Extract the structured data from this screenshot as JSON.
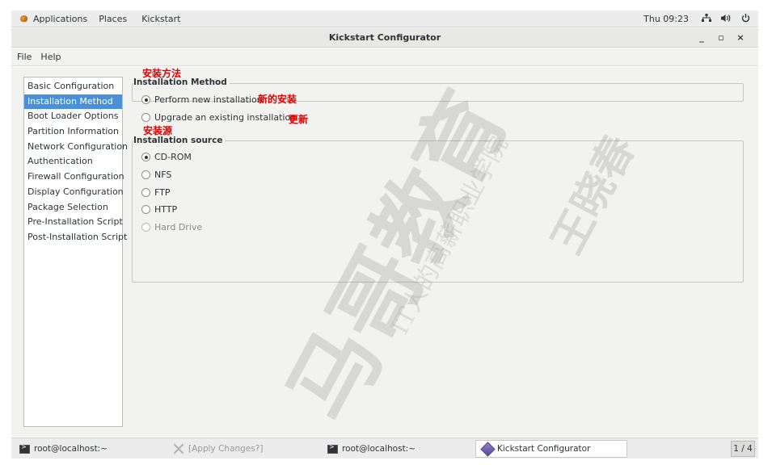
{
  "top_panel": {
    "applications": "Applications",
    "places": "Places",
    "kickstart": "Kickstart",
    "clock": "Thu 09:23"
  },
  "window": {
    "title": "Kickstart Configurator",
    "minimize": "_",
    "maximize": "▫",
    "close": "×"
  },
  "menubar": {
    "file": "File",
    "help": "Help"
  },
  "sidebar": {
    "items": [
      {
        "label": "Basic Configuration",
        "selected": false
      },
      {
        "label": "Installation Method",
        "selected": true
      },
      {
        "label": "Boot Loader Options",
        "selected": false
      },
      {
        "label": "Partition Information",
        "selected": false
      },
      {
        "label": "Network Configuration",
        "selected": false
      },
      {
        "label": "Authentication",
        "selected": false
      },
      {
        "label": "Firewall Configuration",
        "selected": false
      },
      {
        "label": "Display Configuration",
        "selected": false
      },
      {
        "label": "Package Selection",
        "selected": false
      },
      {
        "label": "Pre-Installation Script",
        "selected": false
      },
      {
        "label": "Post-Installation Script",
        "selected": false
      }
    ]
  },
  "installation_method": {
    "label": "Installation Method",
    "options": [
      {
        "label": "Perform new installation",
        "checked": true
      },
      {
        "label": "Upgrade an existing installation",
        "checked": false
      }
    ]
  },
  "installation_source": {
    "label": "Installation source",
    "options": [
      {
        "label": "CD-ROM",
        "checked": true
      },
      {
        "label": "NFS",
        "checked": false
      },
      {
        "label": "FTP",
        "checked": false
      },
      {
        "label": "HTTP",
        "checked": false
      },
      {
        "label": "Hard Drive",
        "checked": false
      }
    ]
  },
  "annotations": {
    "method": "安装方法",
    "new_install": "新的安装",
    "upgrade": "更新",
    "source": "安装源"
  },
  "watermark": {
    "brand": "马哥教育",
    "slogan": "IT人的高薪职业学院",
    "author": "王晓春"
  },
  "taskbar": {
    "tasks": [
      {
        "label": "root@localhost:~",
        "icon": "terminal-icon"
      },
      {
        "label": "[Apply Changes?]",
        "icon": "tools-icon"
      },
      {
        "label": "root@localhost:~",
        "icon": "terminal-icon"
      },
      {
        "label": "Kickstart Configurator",
        "icon": "kickstart-icon"
      }
    ],
    "pager": "1 / 4"
  },
  "colors": {
    "selection": "#4a90d9",
    "annotation": "#e00000",
    "background": "#f2f2f0"
  }
}
